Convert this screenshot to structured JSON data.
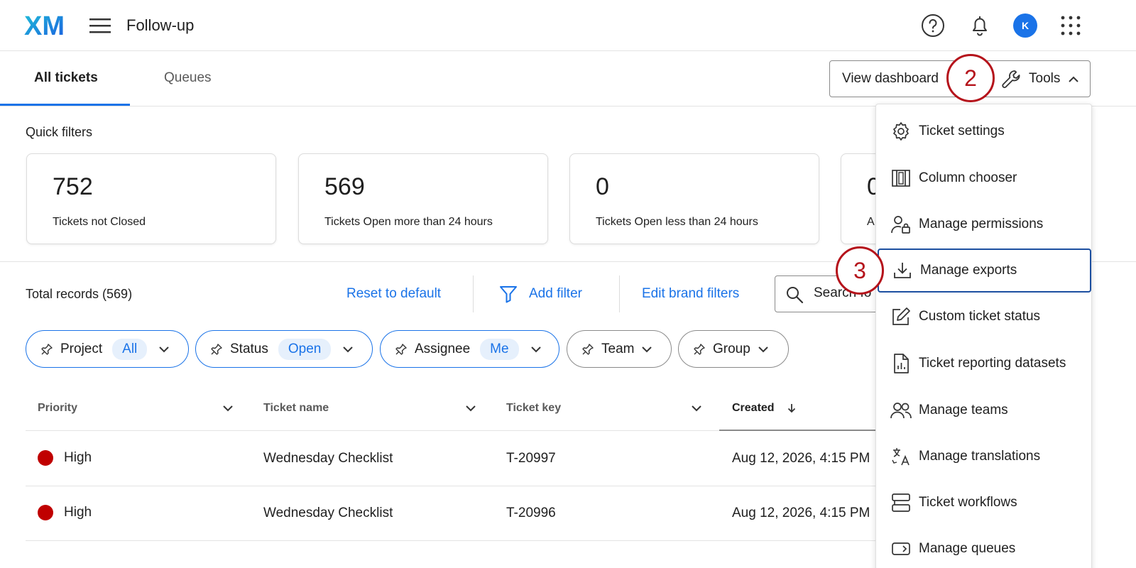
{
  "header": {
    "logo_text": "XM",
    "title": "Follow-up",
    "avatar_initial": "K",
    "colors": {
      "accent": "#1a73e8",
      "annotation": "#b5131b",
      "priority_high": "#c00000"
    }
  },
  "tabs": [
    {
      "label": "All tickets",
      "active": true
    },
    {
      "label": "Queues",
      "active": false
    }
  ],
  "toolbar": {
    "view_dashboard": "View dashboard",
    "tools": "Tools"
  },
  "quick_filters": {
    "label": "Quick filters",
    "cards": [
      {
        "value": "752",
        "label": "Tickets not Closed"
      },
      {
        "value": "569",
        "label": "Tickets Open more than 24 hours"
      },
      {
        "value": "0",
        "label": "Tickets Open less than 24 hours"
      },
      {
        "value": "0",
        "label": "A"
      }
    ]
  },
  "records": {
    "total": "Total records (569)",
    "reset": "Reset to default",
    "add_filter": "Add filter",
    "edit_brand": "Edit brand filters",
    "search_placeholder": "Search fo"
  },
  "chips": [
    {
      "label": "Project",
      "value": "All"
    },
    {
      "label": "Status",
      "value": "Open"
    },
    {
      "label": "Assignee",
      "value": "Me"
    },
    {
      "label": "Team",
      "value": ""
    },
    {
      "label": "Group",
      "value": ""
    }
  ],
  "table": {
    "columns": [
      "Priority",
      "Ticket name",
      "Ticket key",
      "Created"
    ],
    "rows": [
      {
        "priority": "High",
        "name": "Wednesday Checklist",
        "key": "T-20997",
        "created": "Aug 12, 2026, 4:15 PM"
      },
      {
        "priority": "High",
        "name": "Wednesday Checklist",
        "key": "T-20996",
        "created": "Aug 12, 2026, 4:15 PM"
      }
    ]
  },
  "tools_menu": [
    {
      "label": "Ticket settings",
      "icon": "gear-icon"
    },
    {
      "label": "Column chooser",
      "icon": "columns-icon"
    },
    {
      "label": "Manage permissions",
      "icon": "user-lock-icon"
    },
    {
      "label": "Manage exports",
      "icon": "download-icon",
      "highlighted": true
    },
    {
      "label": "Custom ticket status",
      "icon": "edit-icon"
    },
    {
      "label": "Ticket reporting datasets",
      "icon": "report-file-icon"
    },
    {
      "label": "Manage teams",
      "icon": "users-icon"
    },
    {
      "label": "Manage translations",
      "icon": "translate-icon"
    },
    {
      "label": "Ticket workflows",
      "icon": "workflow-icon"
    },
    {
      "label": "Manage queues",
      "icon": "queue-icon"
    }
  ],
  "annotations": [
    "2",
    "3"
  ]
}
